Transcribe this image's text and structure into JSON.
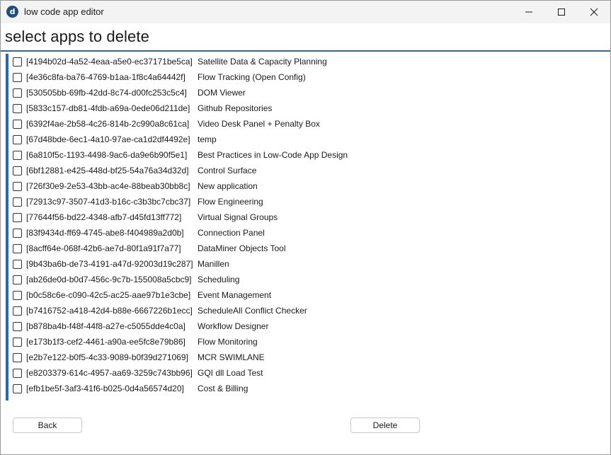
{
  "window": {
    "icon_letter": "d",
    "title": "low code app editor"
  },
  "heading": "select apps to delete",
  "apps": [
    {
      "id": "[4194b02d-4a52-4eaa-a5e0-ec37171be5ca]",
      "name": "Satellite Data & Capacity Planning",
      "checked": false
    },
    {
      "id": "[4e36c8fa-ba76-4769-b1aa-1f8c4a64442f]",
      "name": "Flow Tracking (Open Config)",
      "checked": false
    },
    {
      "id": "[530505bb-69fb-42dd-8c74-d00fc253c5c4]",
      "name": "DOM Viewer",
      "checked": false
    },
    {
      "id": "[5833c157-db81-4fdb-a69a-0ede06d211de]",
      "name": "Github Repositories",
      "checked": false
    },
    {
      "id": "[6392f4ae-2b58-4c26-814b-2c990a8c61ca]",
      "name": "Video Desk Panel + Penalty Box",
      "checked": false
    },
    {
      "id": "[67d48bde-6ec1-4a10-97ae-ca1d2df4492e]",
      "name": "temp",
      "checked": false
    },
    {
      "id": "[6a810f5c-1193-4498-9ac6-da9e6b90f5e1]",
      "name": "Best Practices in Low-Code App Design",
      "checked": false
    },
    {
      "id": "[6bf12881-e425-448d-bf25-54a76a34d32d]",
      "name": "Control Surface",
      "checked": false
    },
    {
      "id": "[726f30e9-2e53-43bb-ac4e-88beab30bb8c]",
      "name": "New application",
      "checked": false
    },
    {
      "id": "[72913c97-3507-41d3-b16c-c3b3bc7cbc37]",
      "name": "Flow Engineering",
      "checked": false
    },
    {
      "id": "[77644f56-bd22-4348-afb7-d45fd13ff772]",
      "name": "Virtual Signal Groups",
      "checked": false
    },
    {
      "id": "[83f9434d-ff69-4745-abe8-f404989a2d0b]",
      "name": "Connection Panel",
      "checked": false
    },
    {
      "id": "[8acff64e-068f-42b6-ae7d-80f1a91f7a77]",
      "name": "DataMiner Objects Tool",
      "checked": false
    },
    {
      "id": "[9b43ba6b-de73-4191-a47d-92003d19c287]",
      "name": "Manillen",
      "checked": false
    },
    {
      "id": "[ab26de0d-b0d7-456c-9c7b-155008a5cbc9]",
      "name": "Scheduling",
      "checked": false
    },
    {
      "id": "[b0c58c6e-c090-42c5-ac25-aae97b1e3cbe]",
      "name": "Event Management",
      "checked": false
    },
    {
      "id": "[b7416752-a418-42d4-b88e-6667226b1ecc]",
      "name": "ScheduleAll Conflict Checker",
      "checked": false
    },
    {
      "id": "[b878ba4b-f48f-44f8-a27e-c5055dde4c0a]",
      "name": "Workflow Designer",
      "checked": false
    },
    {
      "id": "[e173b1f3-cef2-4461-a90a-ee5fc8e79b86]",
      "name": "Flow Monitoring",
      "checked": false
    },
    {
      "id": "[e2b7e122-b0f5-4c33-9089-b0f39d271069]",
      "name": "MCR SWIMLANE",
      "checked": false
    },
    {
      "id": "[e8203379-614c-4957-aa69-3259c743bb96]",
      "name": "GQI dll Load Test",
      "checked": false
    },
    {
      "id": "[efb1be5f-3af3-41f6-b025-0d4a56574d20]",
      "name": "Cost & Billing",
      "checked": false
    }
  ],
  "buttons": {
    "back_label": "Back",
    "delete_label": "Delete"
  },
  "colors": {
    "accent": "#2a6aa6",
    "titlebar": "#f3f3f3",
    "app_icon": "#1f4f7a"
  }
}
